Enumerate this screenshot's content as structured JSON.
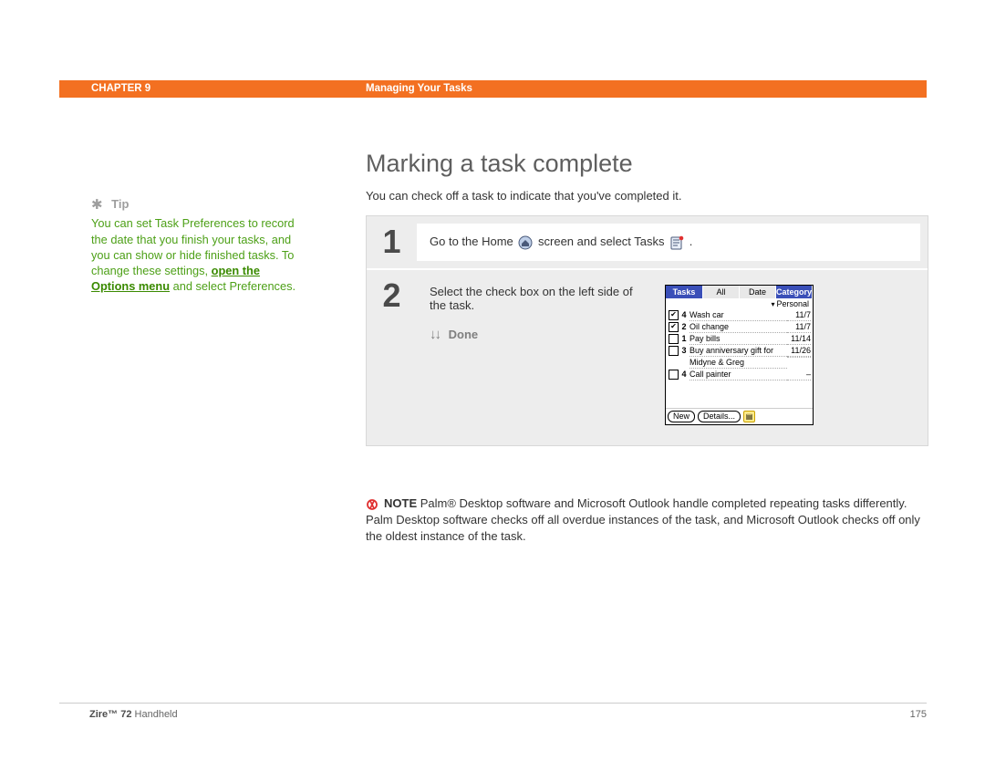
{
  "header": {
    "chapter": "CHAPTER 9",
    "title": "Managing Your Tasks"
  },
  "tip": {
    "label": "Tip",
    "pre": "You can set Task Preferences to record the date that you finish your tasks, and you can show or hide finished tasks. To change these settings, ",
    "link": "open the Options menu",
    "post": " and select Preferences."
  },
  "heading": "Marking a task complete",
  "intro": "You can check off a task to indicate that you've completed it.",
  "step1": {
    "num": "1",
    "pre": "Go to the Home ",
    "mid": " screen and select Tasks ",
    "post": "."
  },
  "step2": {
    "num": "2",
    "text": "Select the check box on the left side of the task.",
    "done": "Done"
  },
  "palm": {
    "tabs": [
      "Tasks",
      "All",
      "Date",
      "Category"
    ],
    "filter": "Personal",
    "rows": [
      {
        "chk": true,
        "pri": "4",
        "txt": "Wash car",
        "dt": "11/7"
      },
      {
        "chk": true,
        "pri": "2",
        "txt": "Oil change",
        "dt": "11/7"
      },
      {
        "chk": false,
        "pri": "1",
        "txt": "Pay bills",
        "dt": "11/14"
      },
      {
        "chk": false,
        "pri": "3",
        "txt": "Buy anniversary gift for",
        "dt": "11/26"
      },
      {
        "cont": true,
        "txt": "Midyne & Greg",
        "dt": ""
      },
      {
        "chk": false,
        "pri": "4",
        "txt": "Call painter",
        "dt": "–"
      }
    ],
    "buttons": {
      "new": "New",
      "details": "Details..."
    }
  },
  "note": {
    "label": "NOTE",
    "text": " Palm® Desktop software and Microsoft Outlook handle completed repeating tasks differently. Palm Desktop software checks off all overdue instances of the task, and Microsoft Outlook checks off only the oldest instance of the task."
  },
  "footer": {
    "model_bold": "Zire™ 72",
    "model_rest": " Handheld",
    "page": "175"
  }
}
